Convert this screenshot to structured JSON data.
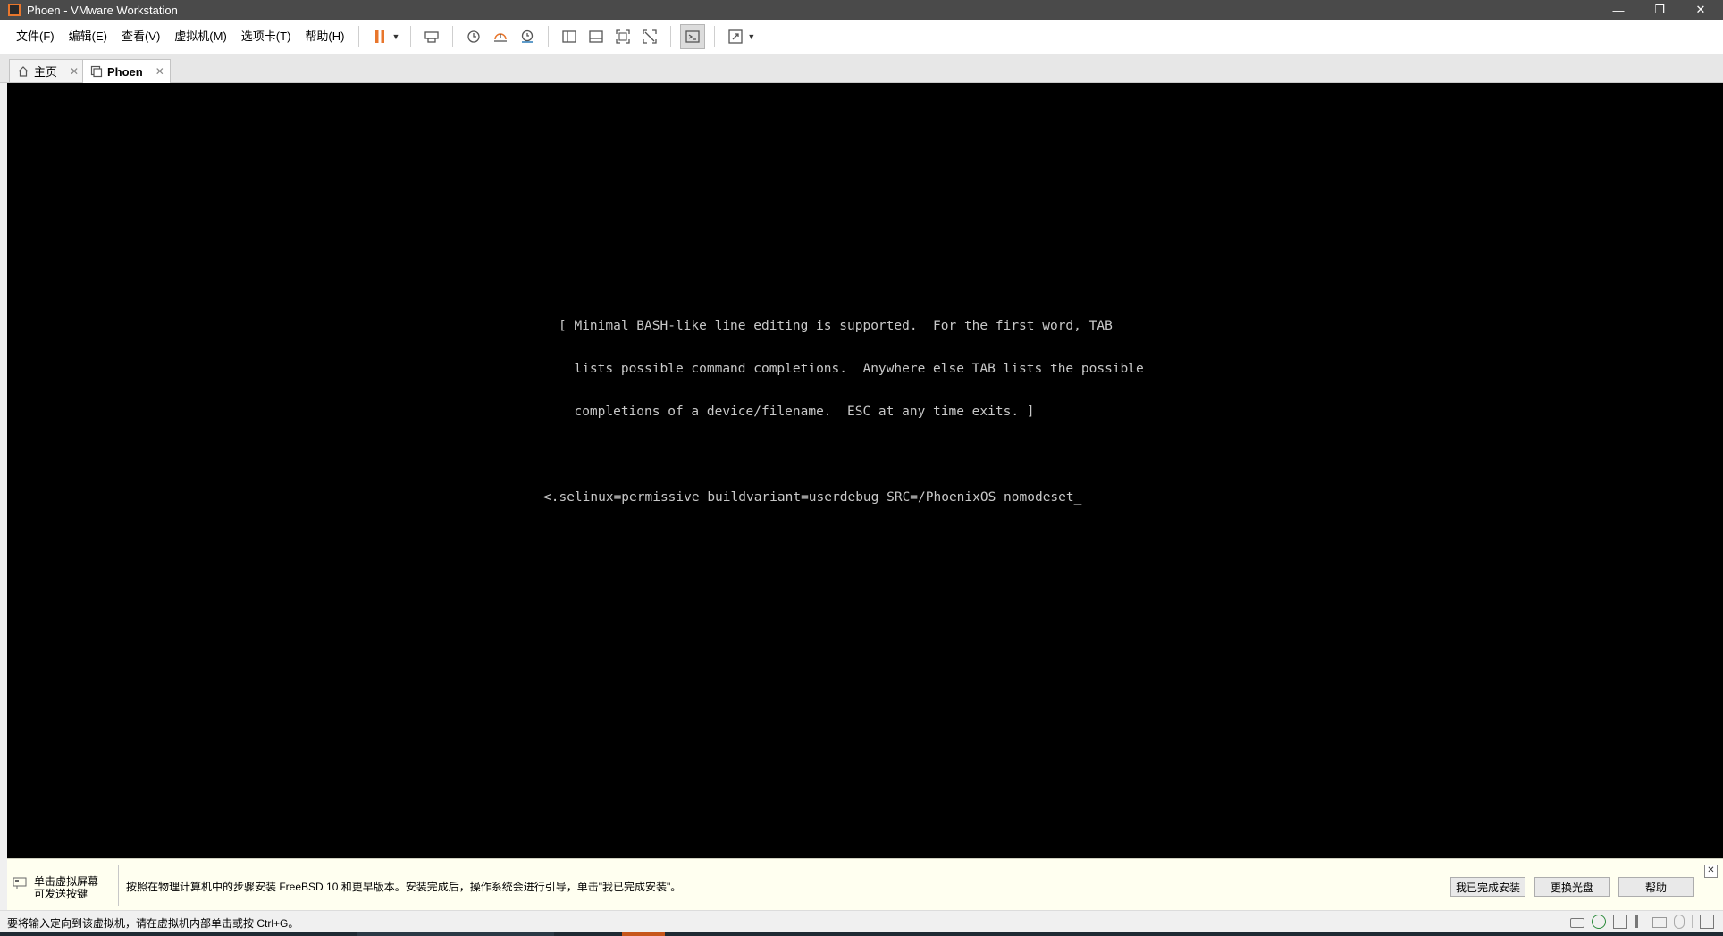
{
  "window": {
    "title": "Phoen - VMware Workstation",
    "controls": {
      "minimize": "—",
      "restore": "❐",
      "close": "✕"
    }
  },
  "menu": {
    "items": [
      "文件(F)",
      "编辑(E)",
      "查看(V)",
      "虚拟机(M)",
      "选项卡(T)",
      "帮助(H)"
    ]
  },
  "toolbar": {
    "icons": [
      "pause-icon",
      "send-keys-icon",
      "snapshot-icon",
      "revert-snapshot-icon",
      "snapshot-manager-icon",
      "sidebar-icon",
      "thumbnail-icon",
      "fullscreen-icon",
      "unity-icon",
      "console-view-icon",
      "stretch-icon"
    ],
    "accent_color": "#e8762c"
  },
  "tabs": [
    {
      "label": "主页",
      "icon": "home-icon",
      "active": false
    },
    {
      "label": "Phoen",
      "icon": "vm-icon",
      "active": true
    }
  ],
  "console": {
    "line1": "[ Minimal BASH-like line editing is supported.  For the first word, TAB",
    "line2": "  lists possible command completions.  Anywhere else TAB lists the possible",
    "line3": "  completions of a device/filename.  ESC at any time exits. ]",
    "command": "<.selinux=permissive buildvariant=userdebug SRC=/PhoenixOS nomodeset_"
  },
  "hint": {
    "left_line1": "单击虚拟屏幕",
    "left_line2": "可发送按键",
    "message": "按照在物理计算机中的步骤安装 FreeBSD 10 和更早版本。安装完成后，操作系统会进行引导，单击\"我已完成安装\"。",
    "buttons": [
      "我已完成安装",
      "更换光盘",
      "帮助"
    ],
    "close": "✕"
  },
  "status": {
    "text": "要将输入定向到该虚拟机，请在虚拟机内部单击或按 Ctrl+G。"
  }
}
